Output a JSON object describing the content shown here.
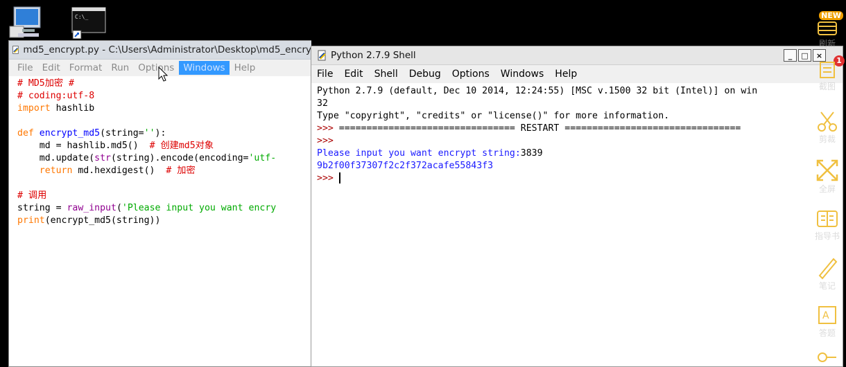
{
  "editor": {
    "title": "md5_encrypt.py - C:\\Users\\Administrator\\Desktop\\md5_encry",
    "menu": [
      "File",
      "Edit",
      "Format",
      "Run",
      "Options",
      "Windows",
      "Help"
    ],
    "active_menu": "Windows",
    "code": {
      "l1": "# MD5加密 #",
      "l2": "# coding:utf-8",
      "l3_kw": "import",
      "l3_rest": " hashlib",
      "l5_kw": "def",
      "l5_fn": " encrypt_md5",
      "l5_p1": "(string=",
      "l5_str": "''",
      "l5_p2": "):",
      "l6_code": "    md = hashlib.md5()  ",
      "l6_cm": "# 创建md5对象",
      "l7_a": "    md.update(",
      "l7_bi": "str",
      "l7_b": "(string).encode(encoding=",
      "l7_str": "'utf-",
      "l8_kw": "    return",
      "l8_code": " md.hexdigest()  ",
      "l8_cm": "# 加密",
      "l10_cm": "# 调用",
      "l11_a": "string = ",
      "l11_bi": "raw_input",
      "l11_b": "(",
      "l11_str": "'Please input you want encry",
      "l12_kw": "print",
      "l12_rest": "(encrypt_md5(string))"
    }
  },
  "shell": {
    "title": "Python 2.7.9 Shell",
    "menu": [
      "File",
      "Edit",
      "Shell",
      "Debug",
      "Options",
      "Windows",
      "Help"
    ],
    "controls": [
      "_",
      "□",
      "×"
    ],
    "lines": {
      "banner1": "Python 2.7.9 (default, Dec 10 2014, 12:24:55) [MSC v.1500 32 bit (Intel)] on win",
      "banner2": "32",
      "banner3": "Type \"copyright\", \"credits\" or \"license()\" for more information.",
      "prompt": ">>>",
      "restart": " ================================ RESTART ================================",
      "input_label": "Please input you want encrypt string:",
      "input_value": "3839",
      "output": "9b2f00f37307f2c2f372acafe55843f3"
    }
  },
  "rightbar": {
    "new_badge": "NEW",
    "count_badge": "1",
    "labels": [
      "刷新",
      "截图",
      "剪裁",
      "全屏",
      "指导书",
      "笔记",
      "答题"
    ]
  },
  "colors": {
    "keyword": "#ff7700",
    "comment": "#dd0000",
    "string": "#00aa00",
    "function": "#0000ff",
    "builtin": "#900090",
    "shell_output": "#1a1aff",
    "shell_prompt": "#aa0000"
  }
}
